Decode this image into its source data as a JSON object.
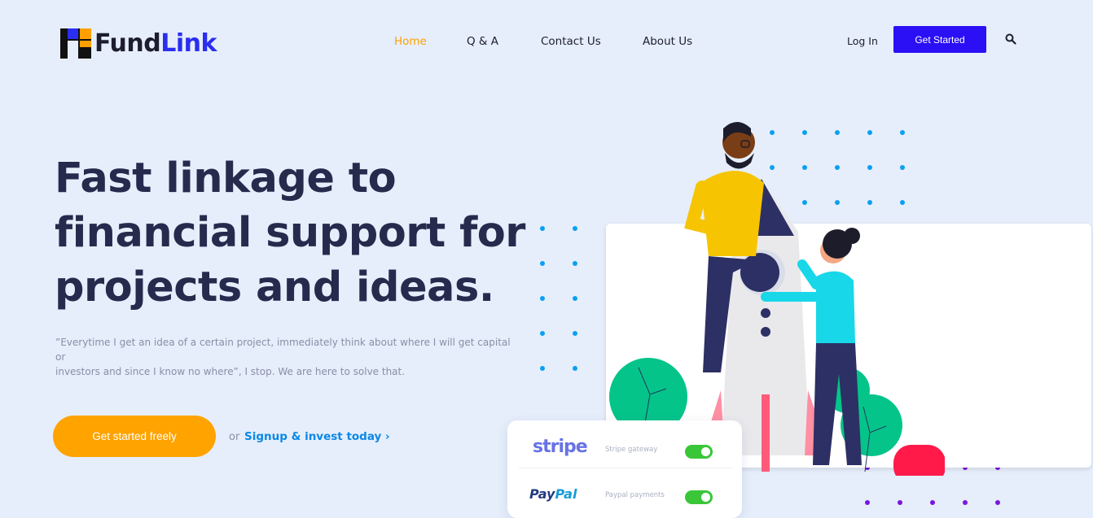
{
  "brand": {
    "part1": "Fund",
    "part2": "Link"
  },
  "nav": {
    "items": [
      {
        "label": "Home",
        "active": true
      },
      {
        "label": "Q & A",
        "active": false
      },
      {
        "label": "Contact Us",
        "active": false
      },
      {
        "label": "About Us",
        "active": false
      }
    ],
    "login_label": "Log In",
    "get_started_label": "Get Started",
    "search_icon": "search-icon"
  },
  "hero": {
    "title_line1": "Fast linkage to",
    "title_line2": "financial support for",
    "title_line3": "projects and ideas.",
    "subtitle_line1": "”Everytime I get an idea of a certain project, immediately think about where I will get capital or",
    "subtitle_line2": "investors and since I know no where”, I stop. We are here to solve that.",
    "cta_label": "Get started freely",
    "or_text": "or",
    "signup_label": "Signup & invest today ›"
  },
  "payments": [
    {
      "logo": "stripe",
      "description": "Stripe gateway",
      "enabled": true
    },
    {
      "logo_part1": "Pay",
      "logo_part2": "Pal",
      "description": "Paypal payments",
      "enabled": true
    }
  ],
  "colors": {
    "background": "#e6eefb",
    "accent_orange": "#ffa300",
    "brand_blue": "#2b0ff5",
    "title_navy": "#262a4d",
    "link_blue": "#0a88e6",
    "toggle_green": "#3ac639"
  }
}
